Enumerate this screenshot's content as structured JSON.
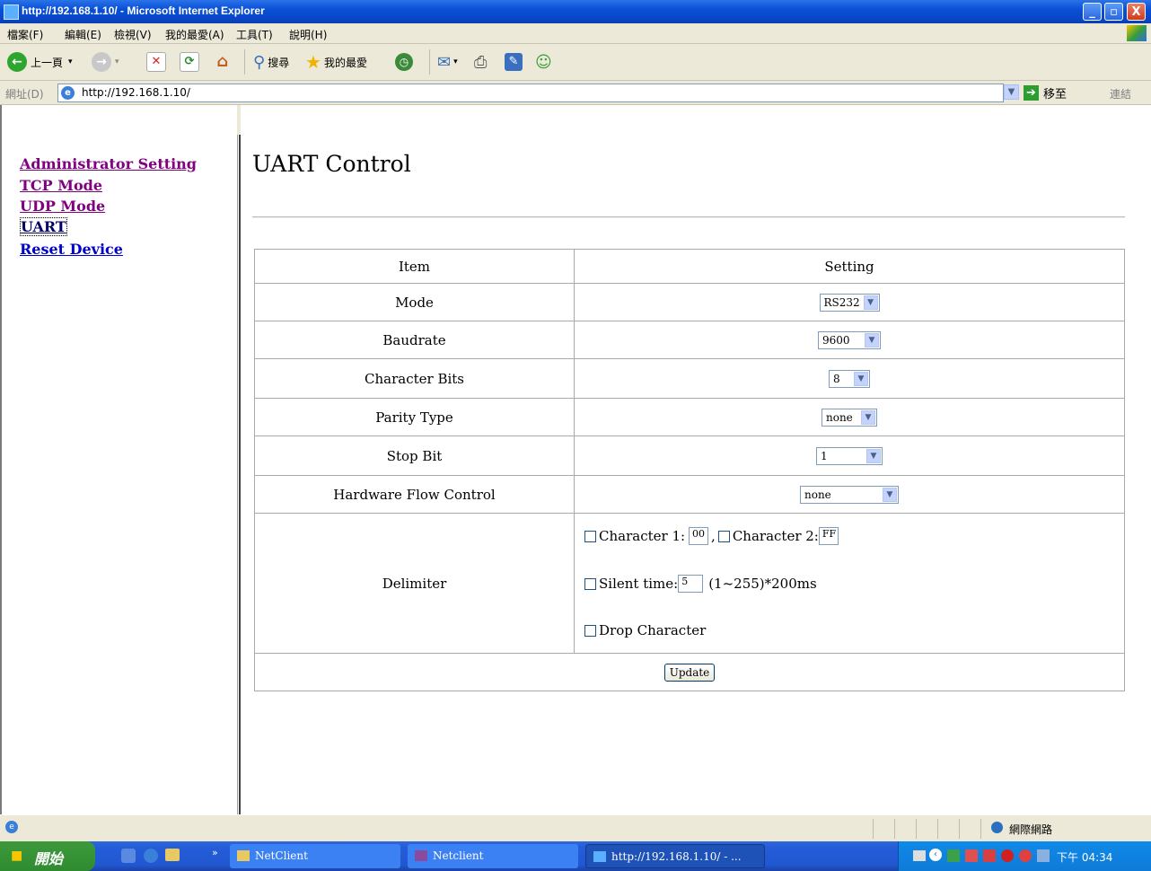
{
  "window": {
    "title": "http://192.168.1.10/ - Microsoft Internet Explorer",
    "minimize": "_",
    "maximize": "▫",
    "close": "X"
  },
  "menu": [
    "檔案(F)",
    "編輯(E)",
    "檢視(V)",
    "我的最愛(A)",
    "工具(T)",
    "說明(H)"
  ],
  "toolbar": {
    "back": "上一頁",
    "search": "搜尋",
    "favorites": "我的最愛"
  },
  "address": {
    "label": "網址(D)",
    "url": "http://192.168.1.10/",
    "go": "移至",
    "links": "連結"
  },
  "nav": {
    "items": [
      {
        "label": "Administrator Setting"
      },
      {
        "label": "TCP Mode"
      },
      {
        "label": "UDP Mode"
      },
      {
        "label": "UART"
      },
      {
        "label": "Reset Device"
      }
    ]
  },
  "page": {
    "title": "UART Control"
  },
  "table": {
    "headers": {
      "item": "Item",
      "setting": "Setting"
    },
    "rows": {
      "mode": {
        "label": "Mode",
        "value": "RS232"
      },
      "baudrate": {
        "label": "Baudrate",
        "value": "9600"
      },
      "charbits": {
        "label": "Character Bits",
        "value": "8"
      },
      "parity": {
        "label": "Parity Type",
        "value": "none"
      },
      "stopbit": {
        "label": "Stop Bit",
        "value": "1"
      },
      "flow": {
        "label": "Hardware Flow Control",
        "value": "none"
      }
    },
    "delimiter": {
      "label": "Delimiter",
      "char1_label": "Character 1:",
      "char1_value": "00",
      "comma": ",",
      "char2_label": "Character 2:",
      "char2_value": "FF",
      "silent_label": "Silent time:",
      "silent_value": "5",
      "silent_range": "(1~255)*200ms",
      "drop_label": "Drop Character"
    },
    "update": "Update"
  },
  "status": {
    "zone": "網際網路"
  },
  "taskbar": {
    "start": "開始",
    "items": [
      "NetClient",
      "Netclient",
      "http://192.168.1.10/ - ..."
    ],
    "clock": "下午 04:34"
  }
}
